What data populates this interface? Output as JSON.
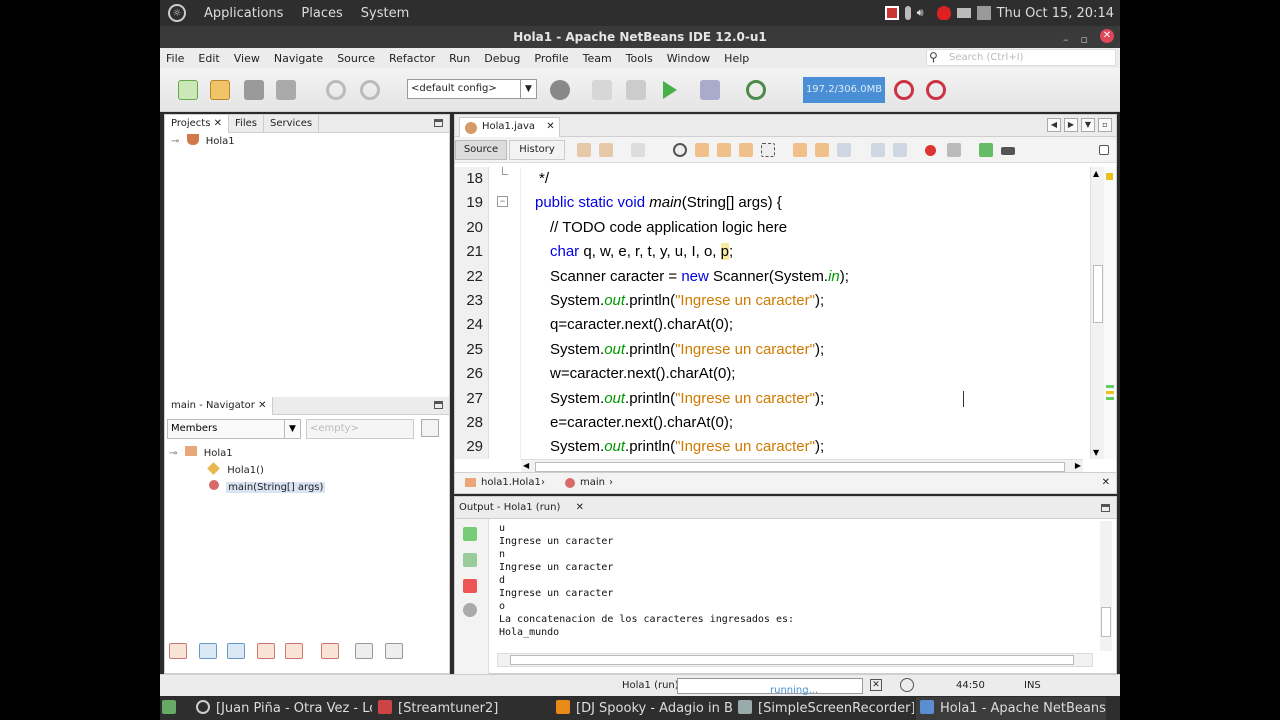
{
  "top_panel": {
    "menus": [
      "Applications",
      "Places",
      "System"
    ],
    "datetime": "Thu Oct 15, 20:14"
  },
  "window": {
    "title": "Hola1 - Apache NetBeans IDE 12.0-u1",
    "min": "–",
    "max": "▫",
    "close": "✕"
  },
  "menubar": {
    "items": [
      "File",
      "Edit",
      "View",
      "Navigate",
      "Source",
      "Refactor",
      "Run",
      "Debug",
      "Profile",
      "Team",
      "Tools",
      "Window",
      "Help"
    ],
    "search_placeholder": "Search (Ctrl+I)"
  },
  "toolbar": {
    "config": "<default config>",
    "memory": "197.2/306.0MB"
  },
  "projects_panel": {
    "tabs": [
      "Projects",
      "Files",
      "Services"
    ],
    "tree_root": "Hola1"
  },
  "navigator": {
    "title": "main - Navigator",
    "members": "Members",
    "empty": "<empty>",
    "root": "Hola1",
    "children": [
      "Hola1()",
      "main(String[] args)"
    ]
  },
  "editor": {
    "tab": "Hola1.java",
    "source": "Source",
    "history": "History",
    "breadcrumb_class": "hola1.Hola1",
    "breadcrumb_method": "main"
  },
  "code": {
    "lines": [
      {
        "n": "18",
        "t": "*/"
      },
      {
        "n": "19",
        "t": "public static void main(String[] args) {"
      },
      {
        "n": "20",
        "t": "// TODO code application logic here"
      },
      {
        "n": "21",
        "t": "char q, w, e, r, t, y, u, I, o, p;"
      },
      {
        "n": "22",
        "t": "Scanner caracter = new Scanner(System.in);"
      },
      {
        "n": "23",
        "t": "System.out.println(\"Ingrese un caracter\");"
      },
      {
        "n": "24",
        "t": "q=caracter.next().charAt(0);"
      },
      {
        "n": "25",
        "t": "System.out.println(\"Ingrese un caracter\");"
      },
      {
        "n": "26",
        "t": "w=caracter.next().charAt(0);"
      },
      {
        "n": "27",
        "t": "System.out.println(\"Ingrese un caracter\");"
      },
      {
        "n": "28",
        "t": "e=caracter.next().charAt(0);"
      },
      {
        "n": "29",
        "t": "System.out.println(\"Ingrese un caracter\");"
      }
    ]
  },
  "output": {
    "title": "Output - Hola1 (run)",
    "lines": [
      "u",
      "Ingrese un caracter",
      "n",
      "Ingrese un caracter",
      "d",
      "Ingrese un caracter",
      "o",
      "La concatenacion de los caracteres ingresados es:",
      "Hola_mundo"
    ]
  },
  "status": {
    "task": "Hola1 (run)",
    "progress": "running...",
    "position": "44:50",
    "mode": "INS"
  },
  "taskbar": {
    "items": [
      "[Juan Piña - Otra Vez - Lo...",
      "[Streamtuner2]",
      "[DJ Spooky - Adagio in Bl...",
      "[SimpleScreenRecorder]",
      "Hola1 - Apache NetBeans..."
    ]
  }
}
